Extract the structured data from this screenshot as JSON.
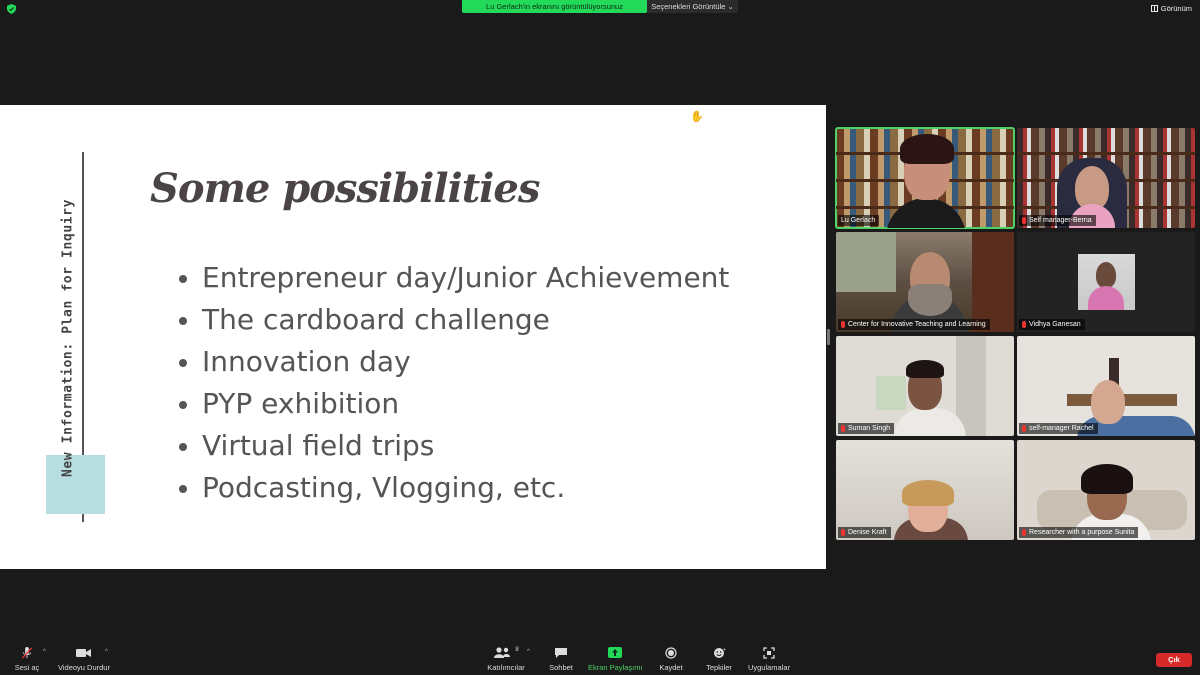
{
  "topbar": {
    "share_banner": "Lu Gerlach'in ekranını görüntülüyorsunuz",
    "view_options": "Seçenekleri Görüntüle",
    "view_button": "Görünüm"
  },
  "slide": {
    "title": "Some possibilities",
    "side_label": "New Information:  Plan for Inquiry",
    "bullets": [
      "Entrepreneur day/Junior Achievement",
      "The cardboard challenge",
      "Innovation day",
      "PYP exhibition",
      "Virtual field trips",
      "Podcasting, Vlogging, etc."
    ]
  },
  "participants": [
    {
      "name": "Lu Gerlach"
    },
    {
      "name": "Self manager-Berna"
    },
    {
      "name": "Center for Innovative Teaching and Learning"
    },
    {
      "name": "Vidhya Ganesan"
    },
    {
      "name": "Suman Singh"
    },
    {
      "name": "self-manager Rachel"
    },
    {
      "name": "Denise Kraft"
    },
    {
      "name": "Researcher with a purpose Sunita"
    }
  ],
  "toolbar": {
    "unmute": "Sesi aç",
    "stop_video": "Videoyu Durdur",
    "participants": "Katılımcılar",
    "participants_count": "8",
    "chat": "Sohbet",
    "share_screen": "Ekran Paylaşımı",
    "record": "Kaydet",
    "reactions": "Tepkiler",
    "apps": "Uygulamalar",
    "leave": "Çık"
  },
  "colors": {
    "active_speaker": "#4ed266",
    "share_banner": "#23d959",
    "leave_button": "#d62a2a",
    "slide_accent": "#b7dde0"
  }
}
